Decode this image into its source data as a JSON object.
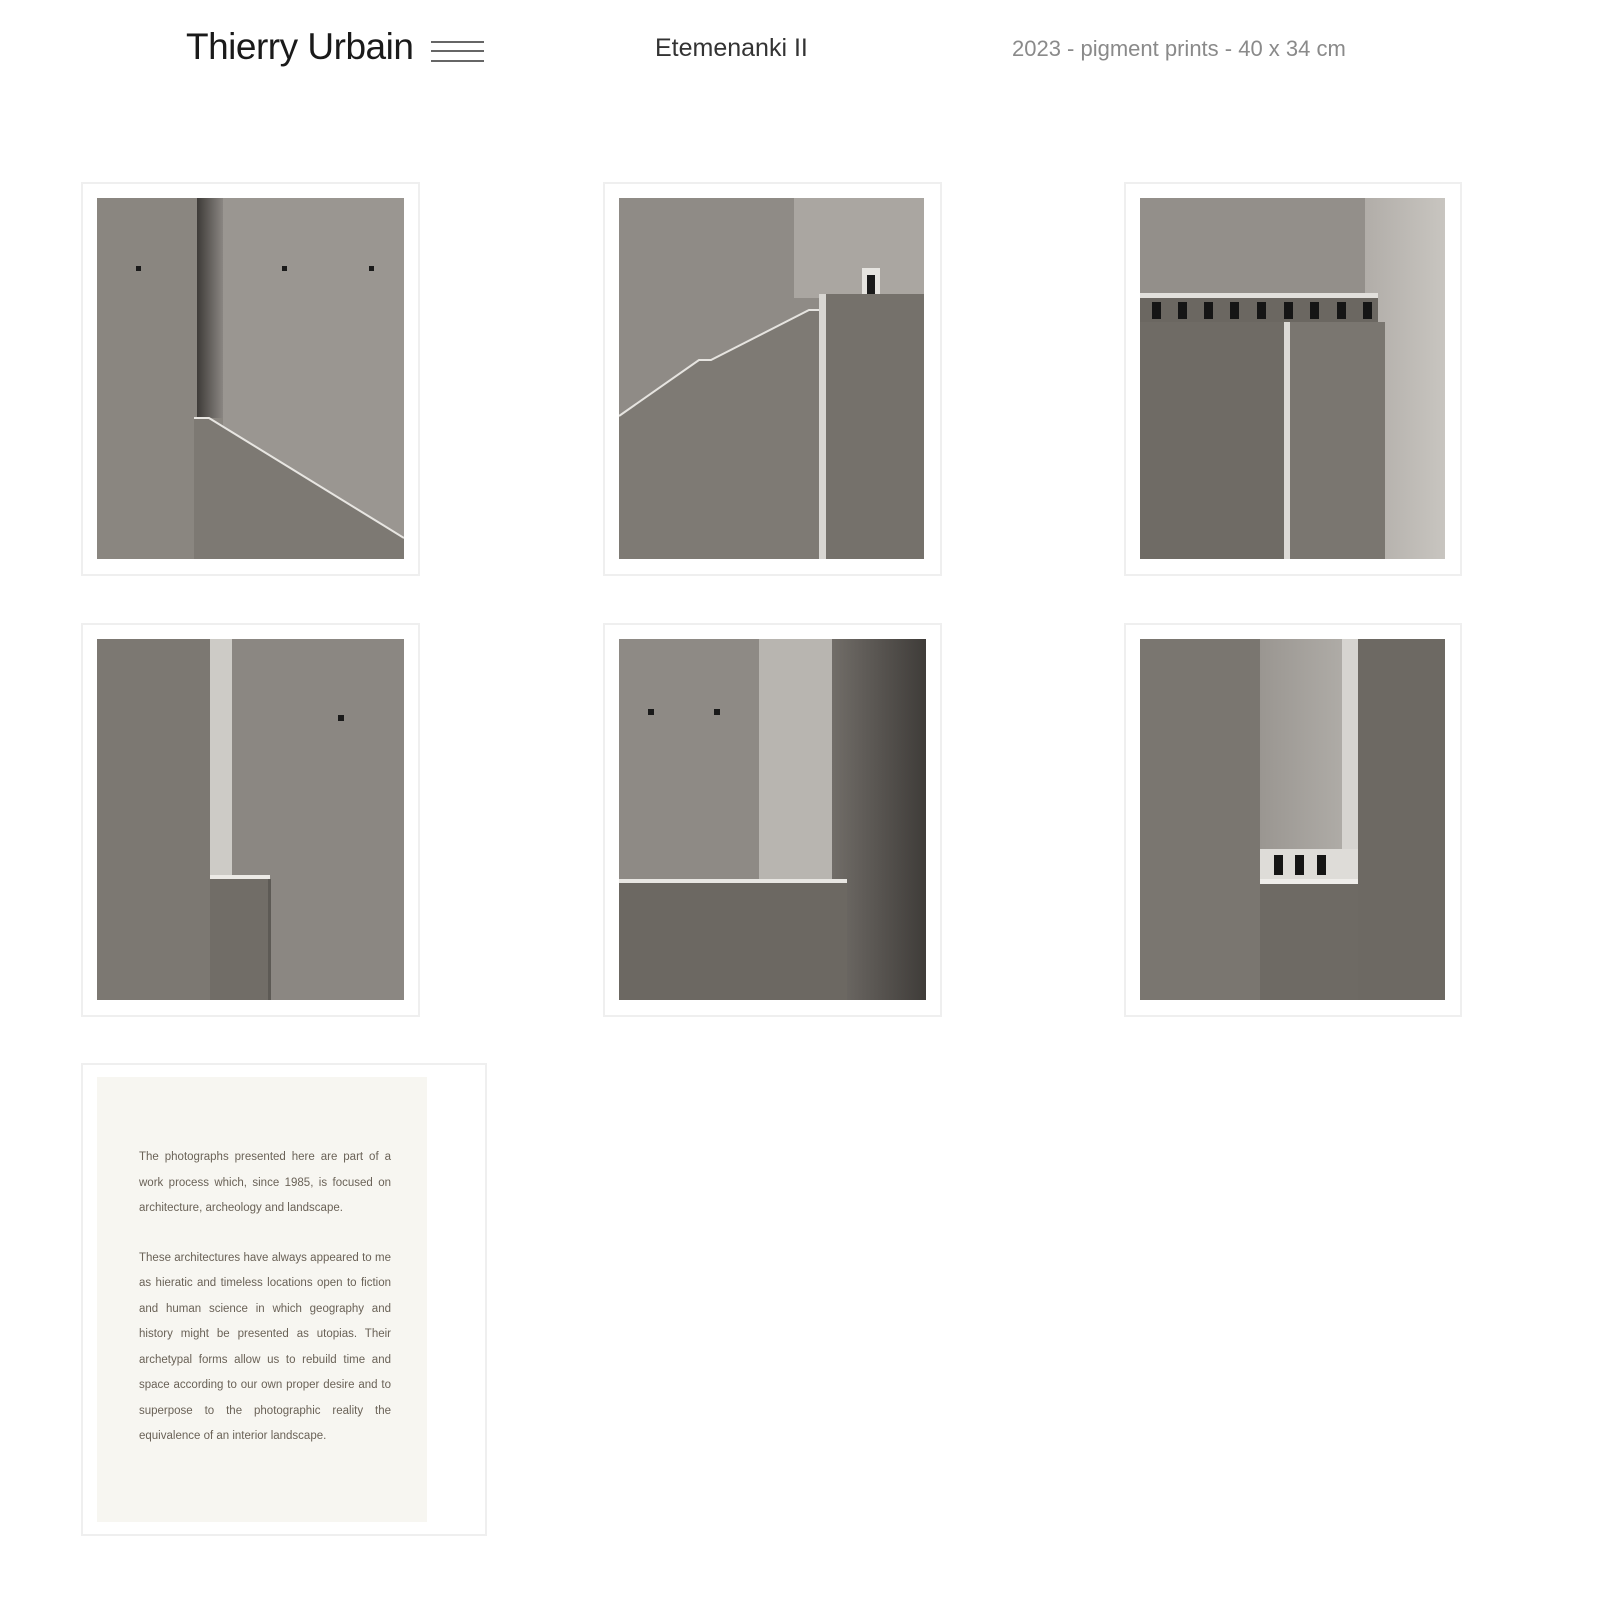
{
  "header": {
    "site_title": "Thierry Urbain",
    "series_title": "Etemenanki II",
    "series_meta": "2023 - pigment prints - 40 x 34 cm"
  },
  "icons": {
    "menu": "hamburger-menu-icon"
  },
  "colors": {
    "page_background": "#ffffff",
    "frame_border": "#efefef",
    "text_card_background": "#f7f6f1",
    "title_text": "#1a1a1a",
    "meta_text": "#8a8a8a"
  },
  "text_card": {
    "paragraphs": [
      "The photographs presented here are part of a work process which, since 1985, is focused on architecture, archeology and landscape.",
      "These architectures have always appeared to me as hieratic and timeless locations open to fiction and human science in which geography and history might be presented as utopias. Their archetypal forms allow us to rebuild time and space according to our own proper desire and to superpose to the photographic reality the equivalence of an interior landscape."
    ]
  }
}
